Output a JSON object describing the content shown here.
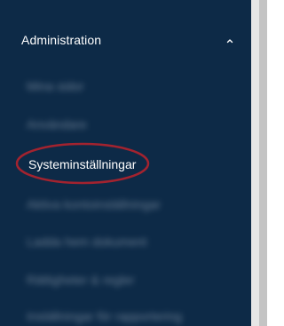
{
  "sidebar": {
    "section_title": "Administration",
    "items": [
      {
        "label": "Mina sidor",
        "state": "blurred"
      },
      {
        "label": "Användare",
        "state": "blurred"
      },
      {
        "label": "Systeminställningar",
        "state": "active"
      },
      {
        "label": "Aktiva kontoinställningar",
        "state": "blurred"
      },
      {
        "label": "Ladda hem dokument",
        "state": "blurred"
      },
      {
        "label": "Rättigheter & regler",
        "state": "blurred"
      },
      {
        "label": "Inställningar för rapportering",
        "state": "blurred"
      }
    ]
  },
  "colors": {
    "sidebar_bg": "#0d2a47",
    "highlight_ring": "#a3232f",
    "text_active": "#ffffff"
  },
  "icons": {
    "section_toggle": "chevron-up-icon"
  }
}
